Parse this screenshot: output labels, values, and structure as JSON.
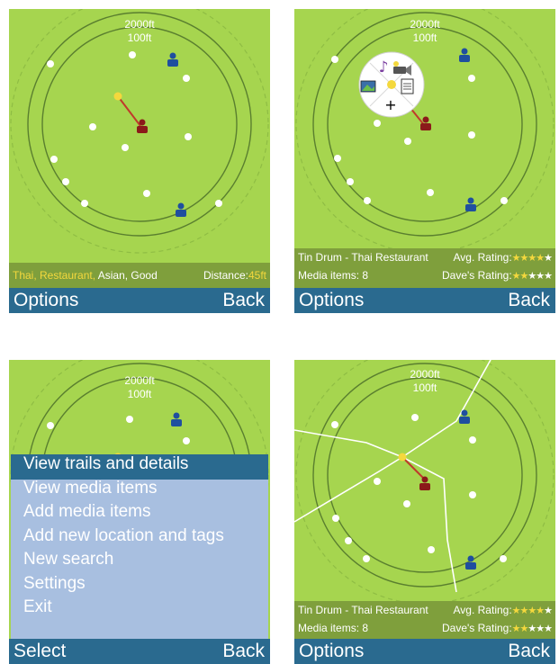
{
  "radar": {
    "outer_label": "2000ft",
    "inner_label": "100ft"
  },
  "colors": {
    "background": "#a6d54f",
    "softkey_bar": "#2a6a8f",
    "info_bar": "#7f9f3c",
    "highlight": "#f4d83d",
    "menu_background": "#a8bfe0",
    "self_marker": "#8b1a1a",
    "friend_marker": "#1f4f9f"
  },
  "screen1": {
    "info": {
      "tag_highlight": "Thai, Restaurant,",
      "tag_rest": " Asian, Good",
      "distance_label": "Distance:",
      "distance_value": "45ft"
    },
    "softkeys": {
      "left": "Options",
      "right": "Back"
    }
  },
  "screen2": {
    "radial_menu_icons": [
      "music-icon",
      "video-camera-icon",
      "image-icon",
      "document-icon",
      "add-icon"
    ],
    "radial_menu_add": "+",
    "info": {
      "place_name": "Tin Drum - Thai Restaurant",
      "avg_rating_label": "Avg. Rating:",
      "media_items": "Media items: 8",
      "daves_rating_label": "Dave's Rating:"
    },
    "softkeys": {
      "left": "Options",
      "right": "Back"
    }
  },
  "screen3": {
    "menu": {
      "items": [
        "View trails and details",
        "View media items",
        "Add media items",
        "Add new location and tags",
        "New search",
        "Settings",
        "Exit"
      ],
      "selected_index": 0
    },
    "softkeys": {
      "left": "Select",
      "right": "Back"
    }
  },
  "screen4": {
    "info": {
      "place_name": "Tin Drum - Thai Restaurant",
      "avg_rating_label": "Avg. Rating:",
      "media_items": "Media items: 8",
      "daves_rating_label": "Dave's Rating:"
    },
    "softkeys": {
      "left": "Options",
      "right": "Back"
    }
  }
}
